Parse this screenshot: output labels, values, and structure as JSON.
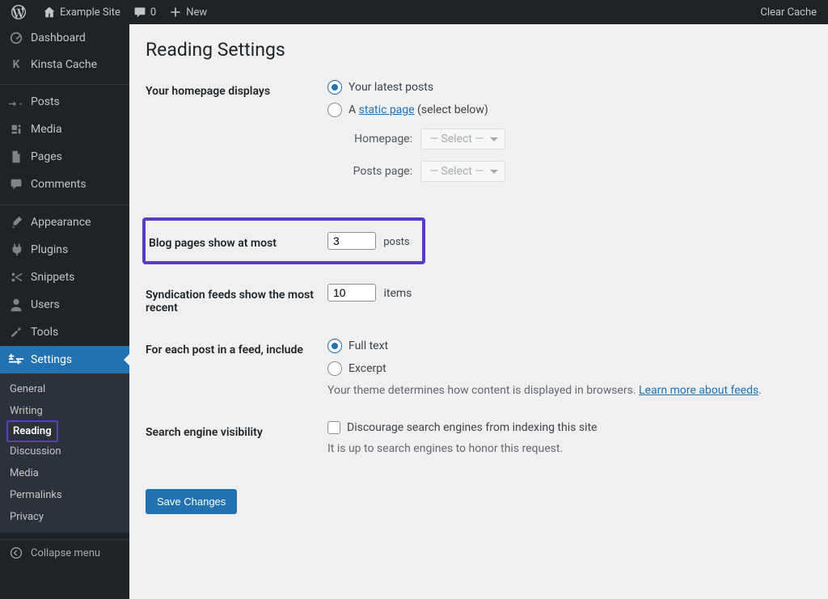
{
  "adminbar": {
    "site_name": "Example Site",
    "comments_count": "0",
    "new_label": "New",
    "clear_cache": "Clear Cache"
  },
  "sidebar": {
    "dashboard": "Dashboard",
    "kinsta": "Kinsta Cache",
    "posts": "Posts",
    "media": "Media",
    "pages": "Pages",
    "comments": "Comments",
    "appearance": "Appearance",
    "plugins": "Plugins",
    "snippets": "Snippets",
    "users": "Users",
    "tools": "Tools",
    "settings": "Settings",
    "submenu": {
      "general": "General",
      "writing": "Writing",
      "reading": "Reading",
      "discussion": "Discussion",
      "media": "Media",
      "permalinks": "Permalinks",
      "privacy": "Privacy"
    },
    "collapse": "Collapse menu"
  },
  "page": {
    "title": "Reading Settings",
    "homepage_label": "Your homepage displays",
    "opt_latest": "Your latest posts",
    "opt_static_prefix": "A ",
    "opt_static_link": "static page",
    "opt_static_suffix": " (select below)",
    "homepage_sel_label": "Homepage:",
    "postspage_sel_label": "Posts page:",
    "select_placeholder": "— Select —",
    "blog_label": "Blog pages show at most",
    "blog_value": "3",
    "blog_unit": "posts",
    "synd_label": "Syndication feeds show the most recent",
    "synd_value": "10",
    "synd_unit": "items",
    "feed_label": "For each post in a feed, include",
    "feed_full": "Full text",
    "feed_excerpt": "Excerpt",
    "feed_desc_prefix": "Your theme determines how content is displayed in browsers. ",
    "feed_desc_link": "Learn more about feeds",
    "feed_desc_suffix": ".",
    "sev_label": "Search engine visibility",
    "sev_checkbox": "Discourage search engines from indexing this site",
    "sev_desc": "It is up to search engines to honor this request.",
    "save": "Save Changes"
  }
}
